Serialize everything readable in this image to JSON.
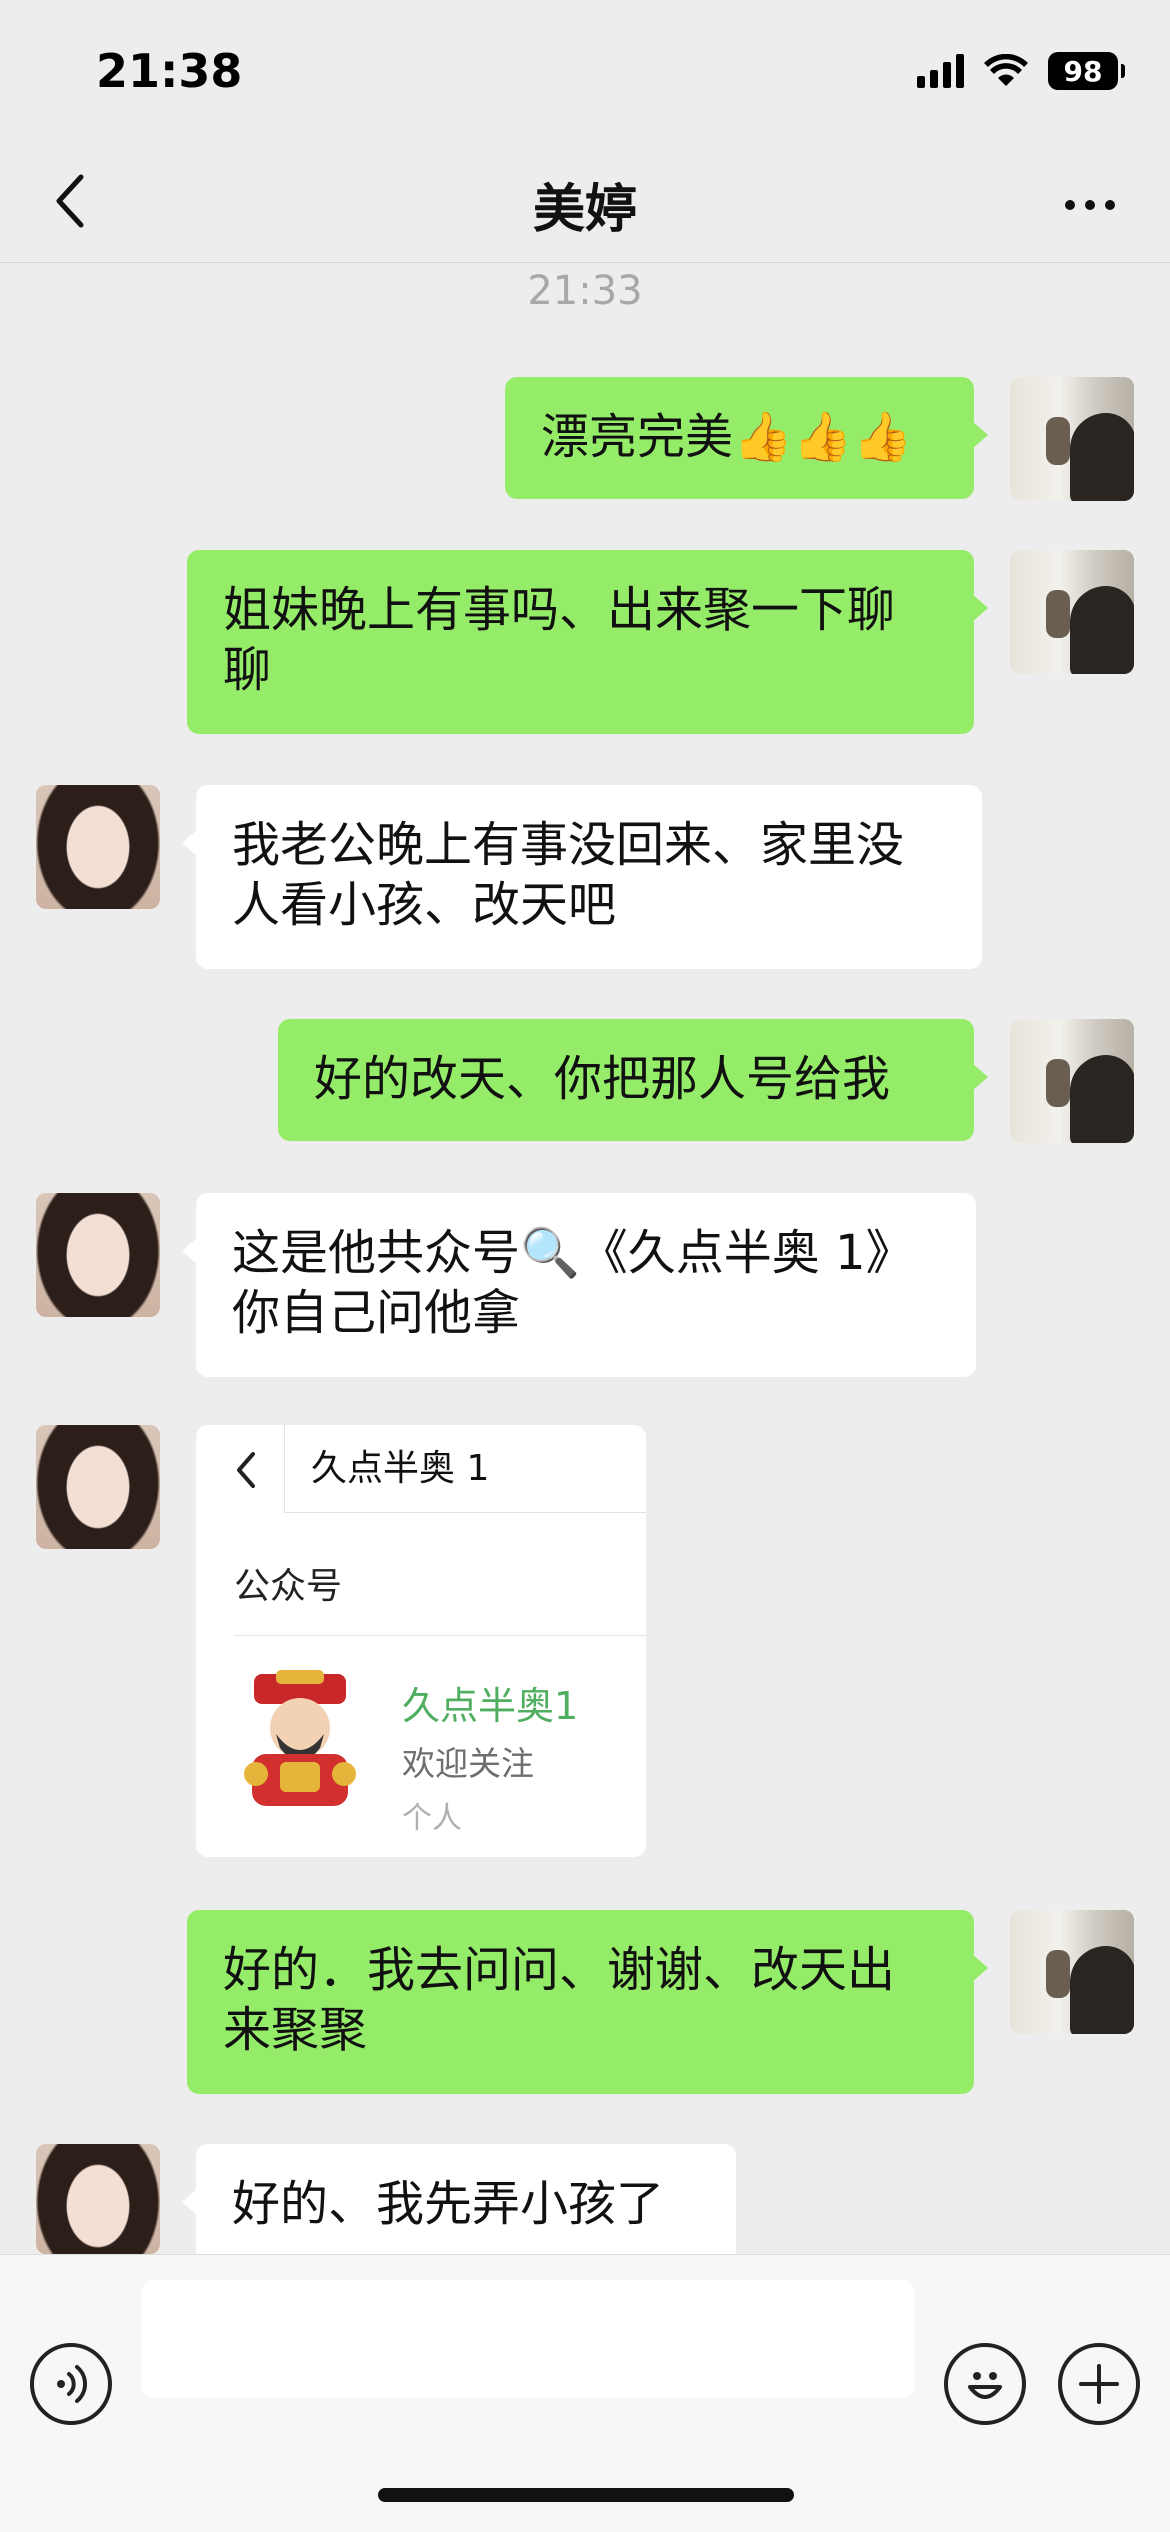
{
  "status_bar": {
    "time": "21:38",
    "battery": "98"
  },
  "nav": {
    "title": "美婷"
  },
  "timestamp": "21:33",
  "messages": [
    {
      "from": "me",
      "text": "漂亮完美👍👍👍"
    },
    {
      "from": "me",
      "text": "姐妹晚上有事吗、出来聚一下聊聊"
    },
    {
      "from": "her",
      "text": "我老公晚上有事没回来、家里没人看小孩、改天吧"
    },
    {
      "from": "me",
      "text": "好的改天、你把那人号给我"
    },
    {
      "from": "her",
      "text": "这是他共众号🔍《久点半奥 1》你自己问他拿"
    },
    {
      "from": "me",
      "text": "好的．我去问问、谢谢、改天出来聚聚"
    },
    {
      "from": "her",
      "text": "好的、我先弄小孩了"
    }
  ],
  "card": {
    "search_text": "久点半奥 1",
    "section_label": "公众号",
    "account_name": "久点半奥1",
    "account_desc": "欢迎关注",
    "account_type": "个人"
  },
  "input": {
    "value": ""
  },
  "colors": {
    "my_bubble": "#95ec69",
    "her_bubble": "#ffffff",
    "card_name": "#4fae5f"
  }
}
